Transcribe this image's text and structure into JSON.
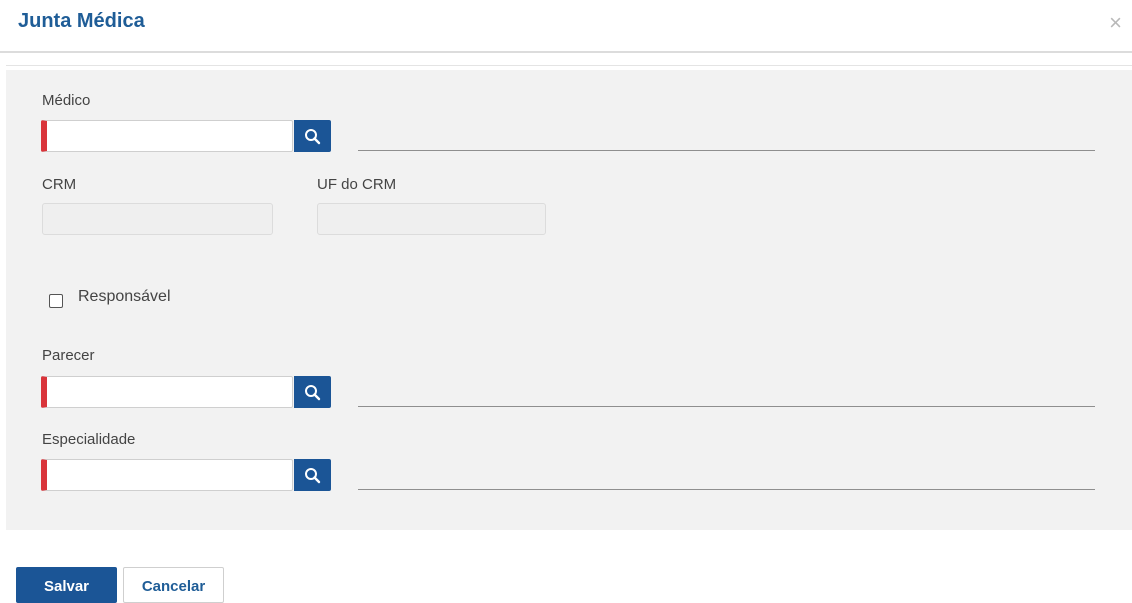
{
  "dialog": {
    "title": "Junta Médica",
    "close_icon": "close-icon"
  },
  "form": {
    "medico": {
      "label": "Médico",
      "value": "",
      "description": ""
    },
    "crm": {
      "label": "CRM",
      "value": ""
    },
    "uf_crm": {
      "label": "UF do CRM",
      "value": ""
    },
    "responsavel": {
      "label": "Responsável",
      "checked": false
    },
    "parecer": {
      "label": "Parecer",
      "value": "",
      "description": ""
    },
    "especialidade": {
      "label": "Especialidade",
      "value": "",
      "description": ""
    }
  },
  "footer": {
    "save_label": "Salvar",
    "cancel_label": "Cancelar"
  },
  "colors": {
    "primary": "#1b5596",
    "title": "#1f5d97",
    "required_marker": "#d9343a",
    "panel_bg": "#f2f2f2"
  }
}
